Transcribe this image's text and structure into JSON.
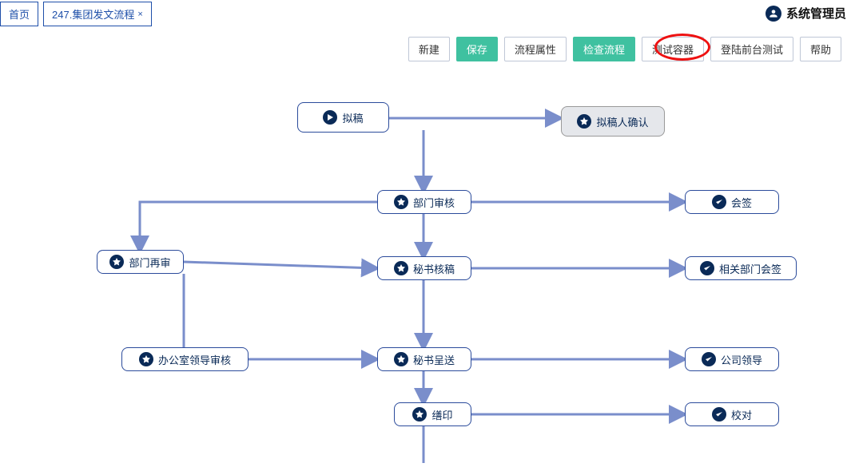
{
  "tabs": {
    "home": "首页",
    "active": "247.集团发文流程",
    "close": "×"
  },
  "user": {
    "name": "系统管理员"
  },
  "toolbar": {
    "new": "新建",
    "save": "保存",
    "props": "流程属性",
    "check": "检查流程",
    "testContainer": "测试容器",
    "loginTest": "登陆前台测试",
    "help": "帮助"
  },
  "nodes": {
    "draft": "拟稿",
    "drafterConfirm": "拟稿人确认",
    "deptReview": "部门审核",
    "countersign": "会签",
    "deptReReview": "部门再审",
    "secretaryCheck": "秘书核稿",
    "relatedDeptSign": "相关部门会签",
    "officeLeaderReview": "办公室领导审核",
    "secretarySubmit": "秘书呈送",
    "companyLeader": "公司领导",
    "seal": "缮印",
    "proofread": "校对"
  }
}
